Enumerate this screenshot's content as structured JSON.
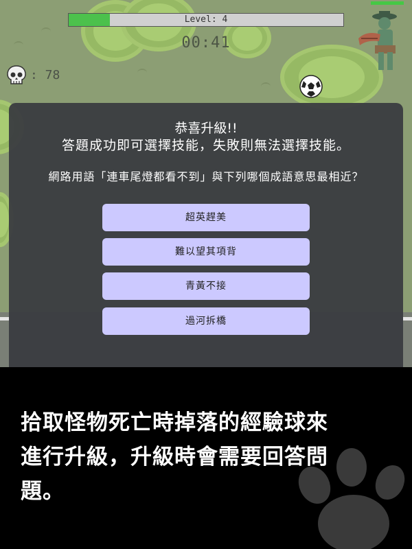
{
  "hud": {
    "level_label": "Level: 4",
    "xp_progress": 0.15,
    "timer": "00:41",
    "kill_count": ": 78"
  },
  "icons": {
    "skull": "skull-icon",
    "ball": "soccer-ball-icon",
    "enemy": "zombie-enemy-icon",
    "paw": "paw-print-icon"
  },
  "modal": {
    "title": "恭喜升級!!",
    "subtitle": "答題成功即可選擇技能，失敗則無法選擇技能。",
    "question": "網路用語「連車尾燈都看不到」與下列哪個成語意思最相近？",
    "answers": [
      "超英趕美",
      "難以望其項背",
      "青黃不接",
      "過河拆橋"
    ]
  },
  "caption": {
    "line1": "拾取怪物死亡時掉落的經驗球來",
    "line2": "進行升級，升級時會需要回答問",
    "line3": "題。"
  },
  "colors": {
    "xp_fill": "#4cc14c",
    "answer_button": "#ccc9ff",
    "modal_bg": "#3a3c40",
    "field": "#8c9e74"
  }
}
